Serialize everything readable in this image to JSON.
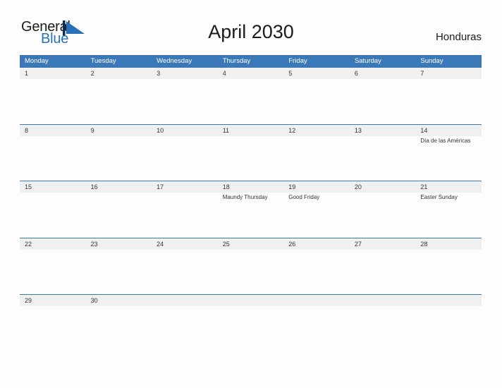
{
  "header": {
    "logo": {
      "text_primary": "General",
      "text_secondary": "Blue",
      "mark_name": "blue-triangle-flag-icon",
      "color_primary": "#1b1b1b",
      "color_secondary": "#2870b8"
    },
    "title": "April 2030",
    "country": "Honduras"
  },
  "theme": {
    "header_blue": "#3b78b8",
    "band_gray": "#f0f0f0",
    "text_dark": "#333333",
    "page_background": "#fdfdfd"
  },
  "calendar": {
    "weekdays": [
      "Monday",
      "Tuesday",
      "Wednesday",
      "Thursday",
      "Friday",
      "Saturday",
      "Sunday"
    ],
    "weeks": [
      [
        {
          "day": "1",
          "event": ""
        },
        {
          "day": "2",
          "event": ""
        },
        {
          "day": "3",
          "event": ""
        },
        {
          "day": "4",
          "event": ""
        },
        {
          "day": "5",
          "event": ""
        },
        {
          "day": "6",
          "event": ""
        },
        {
          "day": "7",
          "event": ""
        }
      ],
      [
        {
          "day": "8",
          "event": ""
        },
        {
          "day": "9",
          "event": ""
        },
        {
          "day": "10",
          "event": ""
        },
        {
          "day": "11",
          "event": ""
        },
        {
          "day": "12",
          "event": ""
        },
        {
          "day": "13",
          "event": ""
        },
        {
          "day": "14",
          "event": "Día de las Américas"
        }
      ],
      [
        {
          "day": "15",
          "event": ""
        },
        {
          "day": "16",
          "event": ""
        },
        {
          "day": "17",
          "event": ""
        },
        {
          "day": "18",
          "event": "Maundy Thursday"
        },
        {
          "day": "19",
          "event": "Good Friday"
        },
        {
          "day": "20",
          "event": ""
        },
        {
          "day": "21",
          "event": "Easter Sunday"
        }
      ],
      [
        {
          "day": "22",
          "event": ""
        },
        {
          "day": "23",
          "event": ""
        },
        {
          "day": "24",
          "event": ""
        },
        {
          "day": "25",
          "event": ""
        },
        {
          "day": "26",
          "event": ""
        },
        {
          "day": "27",
          "event": ""
        },
        {
          "day": "28",
          "event": ""
        }
      ],
      [
        {
          "day": "29",
          "event": ""
        },
        {
          "day": "30",
          "event": ""
        },
        {
          "day": "",
          "event": ""
        },
        {
          "day": "",
          "event": ""
        },
        {
          "day": "",
          "event": ""
        },
        {
          "day": "",
          "event": ""
        },
        {
          "day": "",
          "event": ""
        }
      ]
    ]
  }
}
